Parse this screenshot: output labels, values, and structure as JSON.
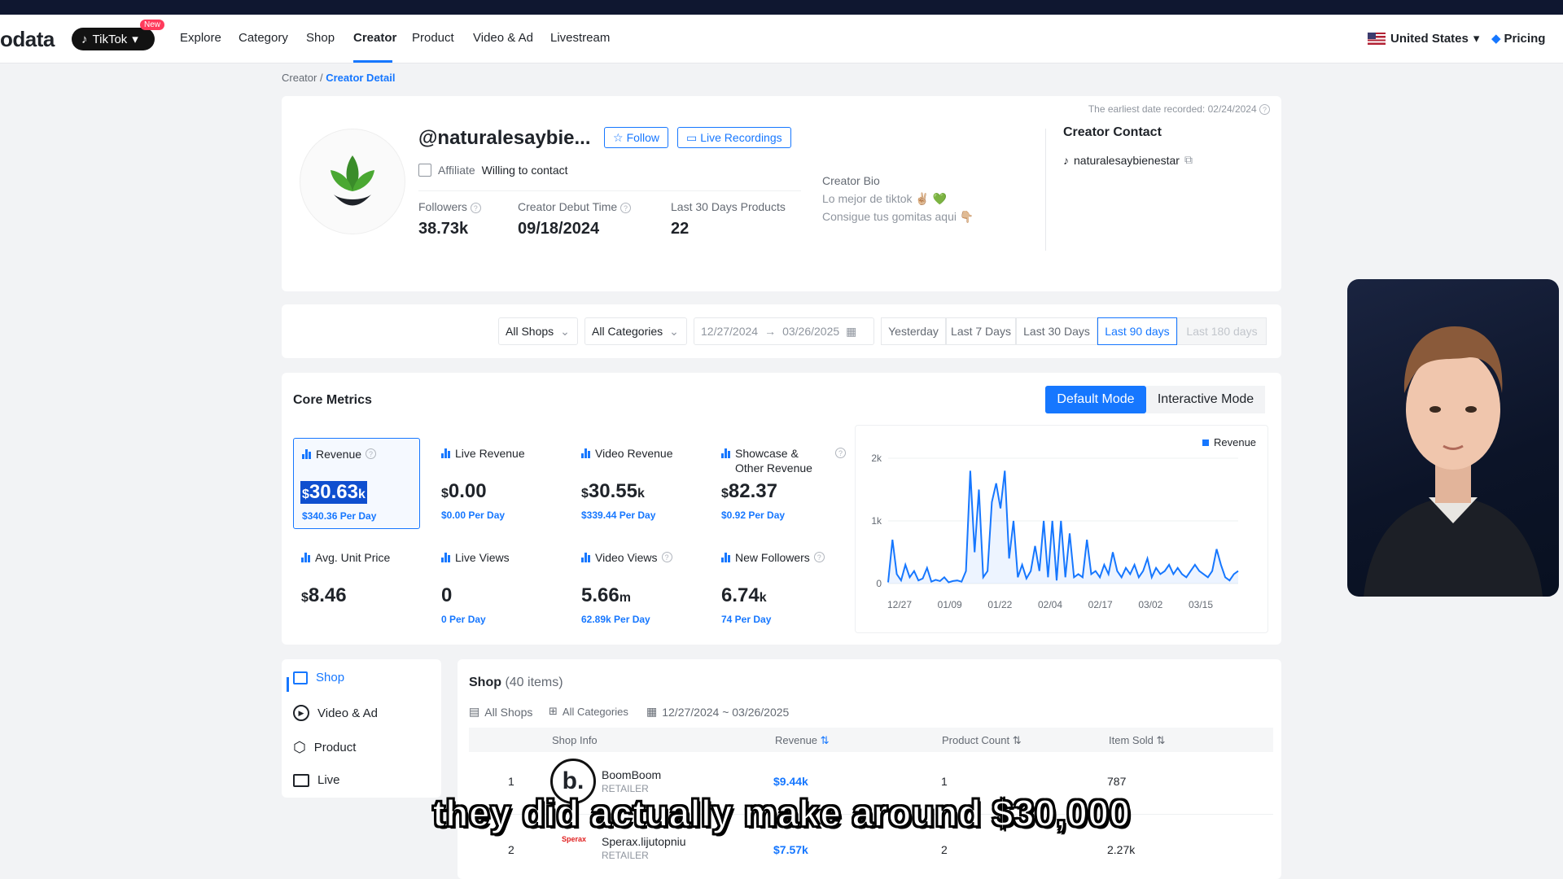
{
  "nav": {
    "logo": "odata",
    "platform": "TikTok",
    "new_badge": "New",
    "items": [
      "Explore",
      "Category",
      "Shop",
      "Creator",
      "Product",
      "Video & Ad",
      "Livestream"
    ],
    "active": "Creator",
    "region": "United States",
    "pricing": "Pricing"
  },
  "breadcrumb": {
    "parent": "Creator",
    "current": "Creator Detail"
  },
  "profile": {
    "handle": "@naturalesaybie...",
    "follow_label": "Follow",
    "live_label": "Live Recordings",
    "type": "Affiliate",
    "contact_status": "Willing to contact",
    "stats": [
      {
        "label": "Followers",
        "value": "38.73k"
      },
      {
        "label": "Creator Debut Time",
        "value": "09/18/2024"
      },
      {
        "label": "Last 30 Days Products",
        "value": "22"
      }
    ],
    "bio_label": "Creator Bio",
    "bio_lines": [
      "Lo mejor de tiktok ✌🏼 💚",
      "Consigue tus gomitas aqui 👇🏼"
    ],
    "earliest": "The earliest date recorded: 02/24/2024",
    "contact_title": "Creator Contact",
    "contact_handle": "naturalesaybienestar"
  },
  "filters": {
    "shops": "All Shops",
    "categories": "All Categories",
    "date_start": "12/27/2024",
    "date_end": "03/26/2025",
    "ranges": [
      "Yesterday",
      "Last 7 Days",
      "Last 30 Days",
      "Last 90 days",
      "Last 180 days"
    ],
    "active_range": "Last 90 days"
  },
  "metrics": {
    "title": "Core Metrics",
    "mode_default": "Default Mode",
    "mode_interactive": "Interactive Mode",
    "items": [
      {
        "label": "Revenue",
        "prefix": "$",
        "value": "30.63",
        "suffix": "k",
        "sub": "$340.36 Per Day"
      },
      {
        "label": "Live Revenue",
        "prefix": "$",
        "value": "0.00",
        "suffix": "",
        "sub": "$0.00 Per Day"
      },
      {
        "label": "Video Revenue",
        "prefix": "$",
        "value": "30.55",
        "suffix": "k",
        "sub": "$339.44 Per Day"
      },
      {
        "label": "Showcase & Other Revenue",
        "prefix": "$",
        "value": "82.37",
        "suffix": "",
        "sub": "$0.92 Per Day"
      },
      {
        "label": "Avg. Unit Price",
        "prefix": "$",
        "value": "8.46",
        "suffix": "",
        "sub": ""
      },
      {
        "label": "Live Views",
        "prefix": "",
        "value": "0",
        "suffix": "",
        "sub": "0 Per Day"
      },
      {
        "label": "Video Views",
        "prefix": "",
        "value": "5.66",
        "suffix": "m",
        "sub": "62.89k Per Day"
      },
      {
        "label": "New Followers",
        "prefix": "",
        "value": "6.74",
        "suffix": "k",
        "sub": "74 Per Day"
      }
    ]
  },
  "chart_data": {
    "type": "line",
    "legend": "Revenue",
    "x_ticks": [
      "12/27",
      "01/09",
      "01/22",
      "02/04",
      "02/17",
      "03/02",
      "03/15"
    ],
    "y_ticks": [
      "0",
      "1k",
      "2k"
    ],
    "ylim": [
      0,
      2000
    ],
    "series": [
      {
        "name": "Revenue",
        "values": [
          20,
          700,
          150,
          50,
          300,
          100,
          200,
          50,
          80,
          250,
          30,
          60,
          40,
          100,
          20,
          40,
          50,
          30,
          200,
          1800,
          500,
          1500,
          100,
          200,
          1300,
          1600,
          1200,
          1800,
          400,
          1000,
          100,
          300,
          80,
          200,
          600,
          200,
          1000,
          100,
          1000,
          50,
          1000,
          100,
          800,
          100,
          150,
          100,
          700,
          150,
          200,
          100,
          300,
          150,
          500,
          200,
          100,
          250,
          150,
          300,
          100,
          200,
          400,
          100,
          250,
          150,
          200,
          300,
          150,
          250,
          150,
          100,
          200,
          300,
          200,
          150,
          100,
          200,
          550,
          300,
          100,
          50,
          150,
          200
        ]
      }
    ]
  },
  "sidebar": [
    "Shop",
    "Video & Ad",
    "Product",
    "Live"
  ],
  "shop_table": {
    "title": "Shop",
    "count": "(40 items)",
    "filter_shops": "All Shops",
    "filter_categories": "All Categories",
    "filter_dates": "12/27/2024 ~ 03/26/2025",
    "headers": [
      "Shop Info",
      "Revenue",
      "Product Count",
      "Item Sold"
    ],
    "rows": [
      {
        "rank": "1",
        "name": "BoomBoom",
        "type": "RETAILER",
        "revenue": "$9.44k",
        "products": "1",
        "sold": "787",
        "logo": "b."
      },
      {
        "rank": "2",
        "name": "Sperax.lijutopniu",
        "type": "RETAILER",
        "revenue": "$7.57k",
        "products": "2",
        "sold": "2.27k",
        "logo": "Sperax"
      }
    ]
  },
  "caption": "they did actually make around $30,000"
}
